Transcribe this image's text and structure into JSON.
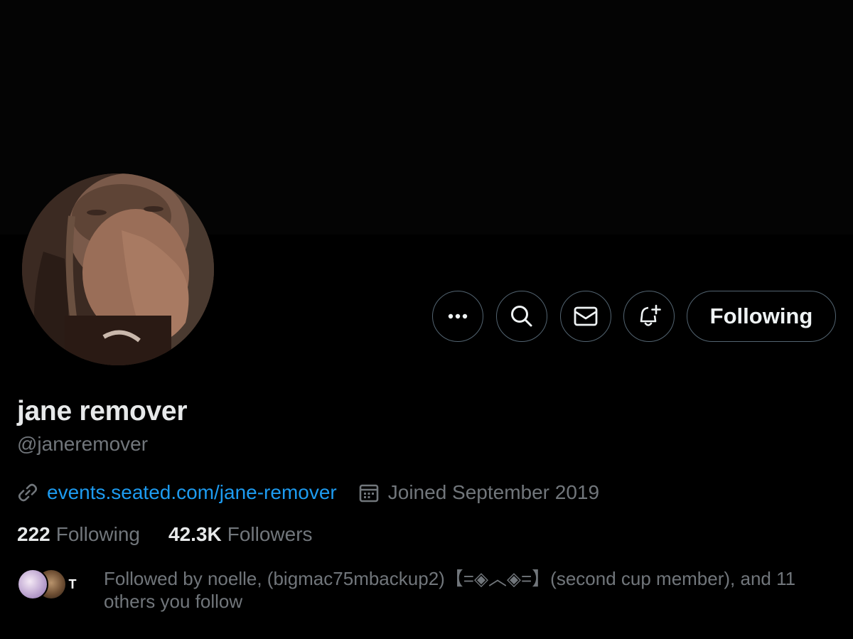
{
  "profile": {
    "display_name": "jane remover",
    "handle": "@janeremover",
    "website": "events.seated.com/jane-remover",
    "joined": "Joined September 2019",
    "avatar_icon": "profile-photo"
  },
  "actions": {
    "more_icon": "more-dots-icon",
    "search_icon": "search-icon",
    "message_icon": "envelope-icon",
    "notify_icon": "bell-plus-icon",
    "following_label": "Following"
  },
  "stats": {
    "following_count": "222",
    "following_label": "Following",
    "followers_count": "42.3K",
    "followers_label": "Followers"
  },
  "followed_by": {
    "text": "Followed by noelle, (bigmac75mbackup2)【=◈︿◈=】(second cup member), and 11 others you follow",
    "third_avatar_letter": "T"
  },
  "colors": {
    "background": "#000000",
    "text_primary": "#e7e9ea",
    "text_secondary": "#71767b",
    "link": "#1d9bf0",
    "border": "#536471"
  }
}
